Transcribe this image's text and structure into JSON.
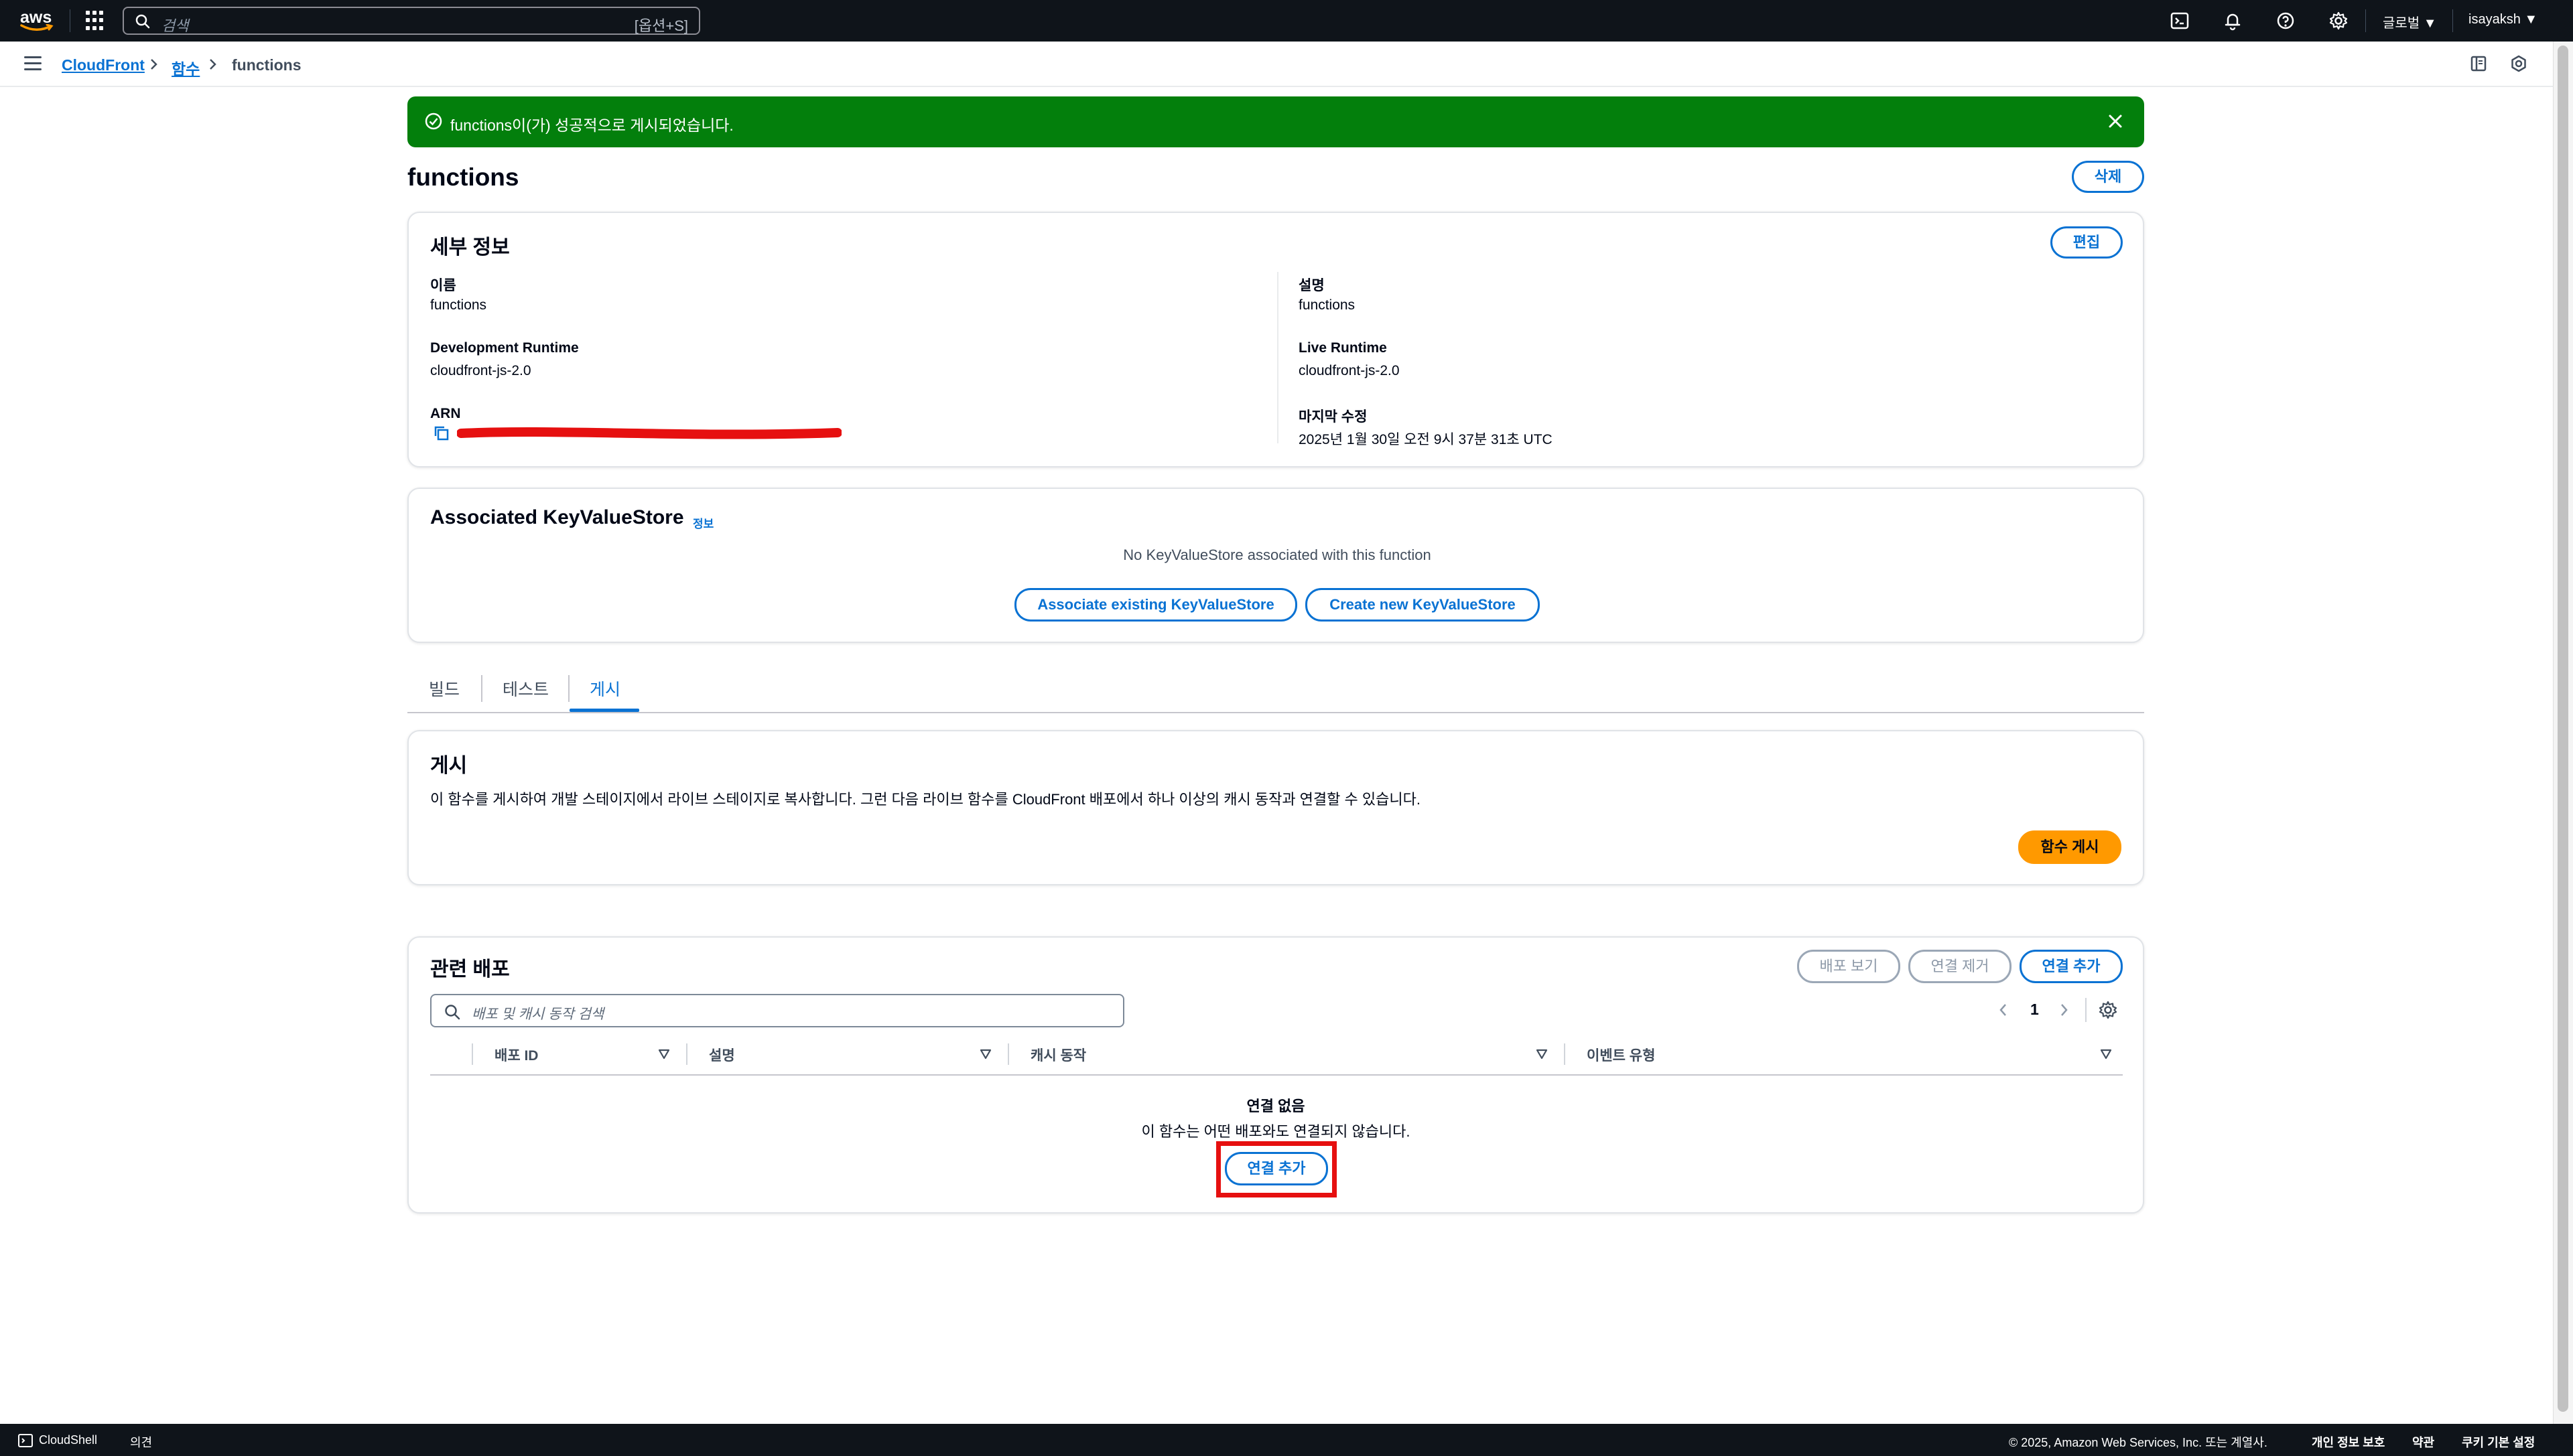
{
  "topnav": {
    "logo_text": "aws",
    "search_placeholder": "검색",
    "search_shortcut": "[옵션+S]",
    "region": "글로벌 ▼",
    "user": "isayaksh ▼",
    "icons": [
      "cloudshell-icon",
      "bell-icon",
      "help-icon",
      "gear-icon"
    ]
  },
  "breadcrumb": {
    "items": [
      "CloudFront",
      "함수",
      "functions"
    ]
  },
  "flash": {
    "message": "functions이(가) 성공적으로 게시되었습니다."
  },
  "page": {
    "title": "functions",
    "delete_label": "삭제"
  },
  "details": {
    "header": "세부 정보",
    "edit_label": "편집",
    "name_label": "이름",
    "name_value": "functions",
    "dev_runtime_label": "Development Runtime",
    "dev_runtime_value": "cloudfront-js-2.0",
    "arn_label": "ARN",
    "desc_label": "설명",
    "desc_value": "functions",
    "live_runtime_label": "Live Runtime",
    "live_runtime_value": "cloudfront-js-2.0",
    "modified_label": "마지막 수정",
    "modified_value": "2025년 1월 30일 오전 9시 37분 31초 UTC"
  },
  "kvs": {
    "header": "Associated KeyValueStore",
    "info": "정보",
    "empty": "No KeyValueStore associated with this function",
    "associate_label": "Associate existing KeyValueStore",
    "create_label": "Create new KeyValueStore"
  },
  "tabs": [
    {
      "label": "빌드",
      "active": false
    },
    {
      "label": "테스트",
      "active": false
    },
    {
      "label": "게시",
      "active": true
    }
  ],
  "publish": {
    "header": "게시",
    "description": "이 함수를 게시하여 개발 스테이지에서 라이브 스테이지로 복사합니다. 그런 다음 라이브 함수를 CloudFront 배포에서 하나 이상의 캐시 동작과 연결할 수 있습니다.",
    "button_label": "함수 게시"
  },
  "distributions": {
    "header": "관련 배포",
    "view_label": "배포 보기",
    "remove_label": "연결 제거",
    "add_label": "연결 추가",
    "search_placeholder": "배포 및 캐시 동작 검색",
    "page": "1",
    "columns": [
      "배포 ID",
      "설명",
      "캐시 동작",
      "이벤트 유형"
    ],
    "empty_title": "연결 없음",
    "empty_desc": "이 함수는 어떤 배포와도 연결되지 않습니다.",
    "empty_add_label": "연결 추가"
  },
  "footer": {
    "cloudshell": "CloudShell",
    "feedback": "의견",
    "copyright": "© 2025, Amazon Web Services, Inc. 또는 계열사.",
    "privacy": "개인 정보 보호",
    "terms": "약관",
    "cookies": "쿠키 기본 설정"
  },
  "colors": {
    "nav_bg": "#0f141a",
    "link": "#0972d3",
    "success": "#037f0c",
    "primary": "#ff9900",
    "highlight": "#e61010"
  }
}
